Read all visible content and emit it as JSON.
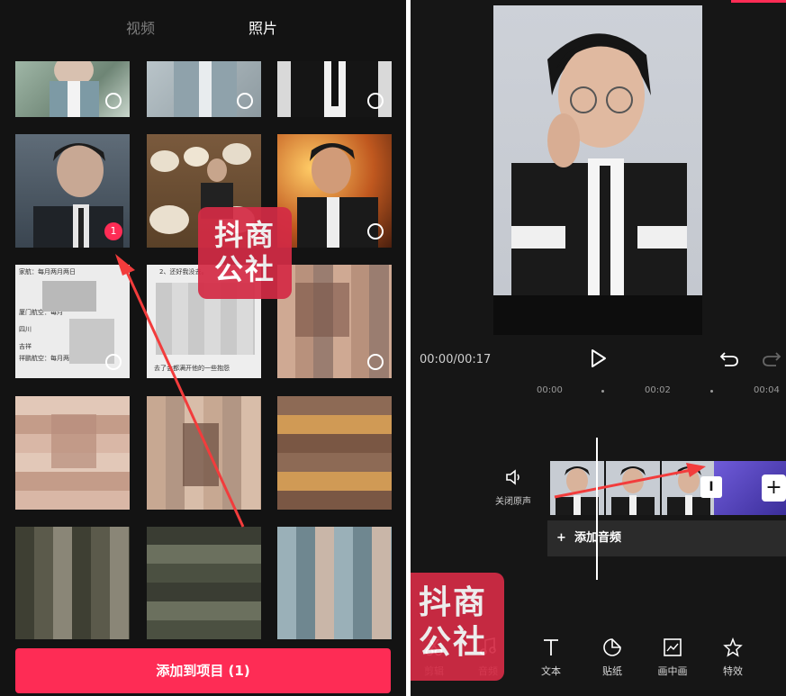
{
  "left_panel": {
    "tabs": {
      "video": "视频",
      "photo": "照片"
    },
    "selected_badge": "1",
    "add_button": "添加到项目 (1)",
    "doc_thumb_lines": [
      "家航：每月两月两日",
      "厦门航空：每月",
      "四川",
      "吉祥",
      "祥鹏航空：每月两月"
    ],
    "doc_thumb2_lines": [
      "2、还好我没去。",
      "去了会都满开他的一些抱怨"
    ]
  },
  "watermark": {
    "line1": "抖商",
    "line2": "公社"
  },
  "right_panel": {
    "time": "00:00/00:17",
    "ruler": [
      "00:00",
      "00:02",
      "00:04"
    ],
    "mute_label": "关闭原声",
    "add_audio": "添加音频",
    "cut_icon": "I",
    "plus_icon": "+",
    "toolbar": [
      {
        "label": "剪辑"
      },
      {
        "label": "音频"
      },
      {
        "label": "文本"
      },
      {
        "label": "贴纸"
      },
      {
        "label": "画中画"
      },
      {
        "label": "特效"
      }
    ]
  },
  "colors": {
    "accent": "#fe2c55",
    "watermark": "#d42b45"
  }
}
